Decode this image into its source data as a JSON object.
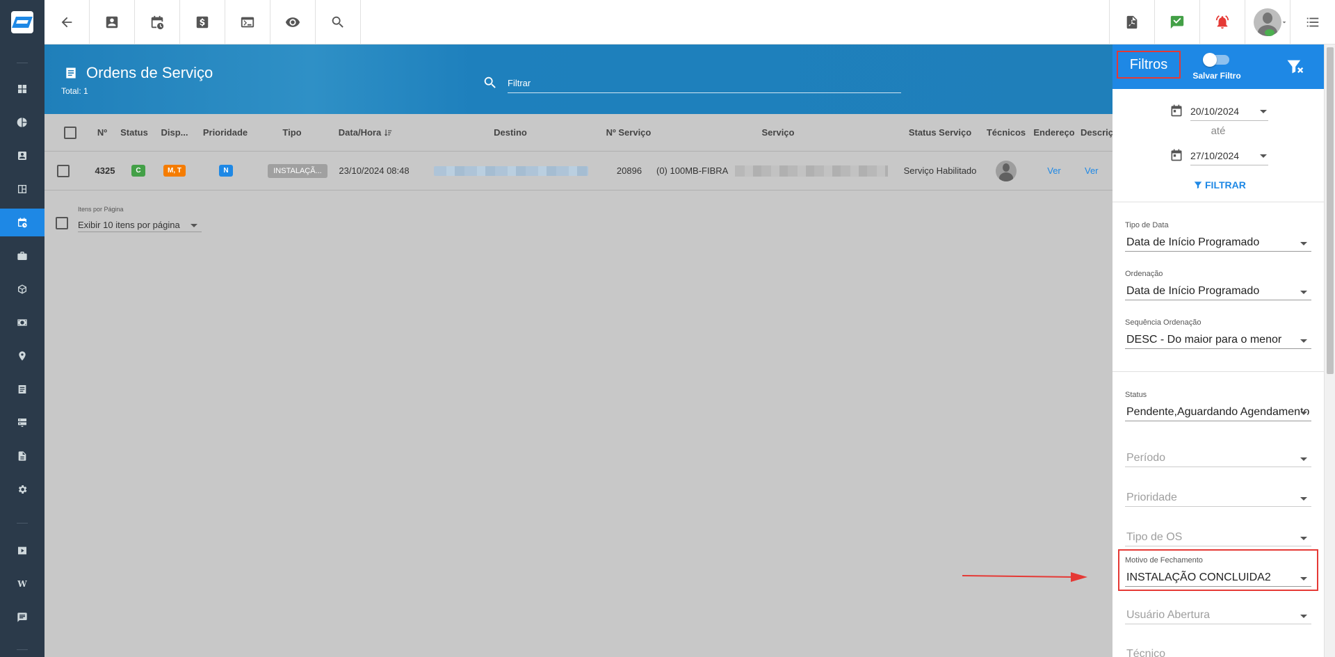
{
  "header": {
    "title": "Ordens de Serviço",
    "total": "Total: 1",
    "search_placeholder": "Filtrar"
  },
  "table": {
    "columns": [
      "Nº",
      "Status",
      "Disp...",
      "Prioridade",
      "Tipo",
      "Data/Hora",
      "Destino",
      "Nº Serviço",
      "Serviço",
      "Status Serviço",
      "Técnicos",
      "Endereço",
      "Descriç"
    ],
    "rows": [
      {
        "numero": "4325",
        "status": "C",
        "disp": "M, T",
        "prioridade": "N",
        "tipo": "INSTALAÇÃ...",
        "data_hora": "23/10/2024 08:48",
        "n_servico": "20896",
        "servico": "(0) 100MB-FIBRA",
        "status_servico": "Serviço Habilitado",
        "endereco": "Ver",
        "descricao": "Ver"
      }
    ]
  },
  "pagination": {
    "label": "Itens por Página",
    "value": "Exibir 10 itens por página"
  },
  "filters": {
    "title": "Filtros",
    "save_label": "Salvar Filtro",
    "date_from": "20/10/2024",
    "date_sep": "até",
    "date_to": "27/10/2024",
    "apply_label": "FILTRAR",
    "tipo_data": {
      "label": "Tipo de Data",
      "value": "Data de Início Programado"
    },
    "ordenacao": {
      "label": "Ordenação",
      "value": "Data de Início Programado"
    },
    "sequencia": {
      "label": "Sequência Ordenação",
      "value": "DESC - Do maior para o menor"
    },
    "status": {
      "label": "Status",
      "value": "Pendente,Aguardando Agendamento"
    },
    "periodo": {
      "placeholder": "Período"
    },
    "prioridade": {
      "placeholder": "Prioridade"
    },
    "tipo_os": {
      "placeholder": "Tipo de OS"
    },
    "motivo": {
      "label": "Motivo de Fechamento",
      "value": "INSTALAÇÃO CONCLUIDA2"
    },
    "usuario": {
      "placeholder": "Usuário Abertura"
    },
    "tecnico": {
      "placeholder": "Técnico"
    }
  },
  "colors": {
    "header_blue": "#1f7fba",
    "accent": "#1e88e5",
    "sidebar": "#2b3a4a",
    "highlight": "#e53935"
  }
}
